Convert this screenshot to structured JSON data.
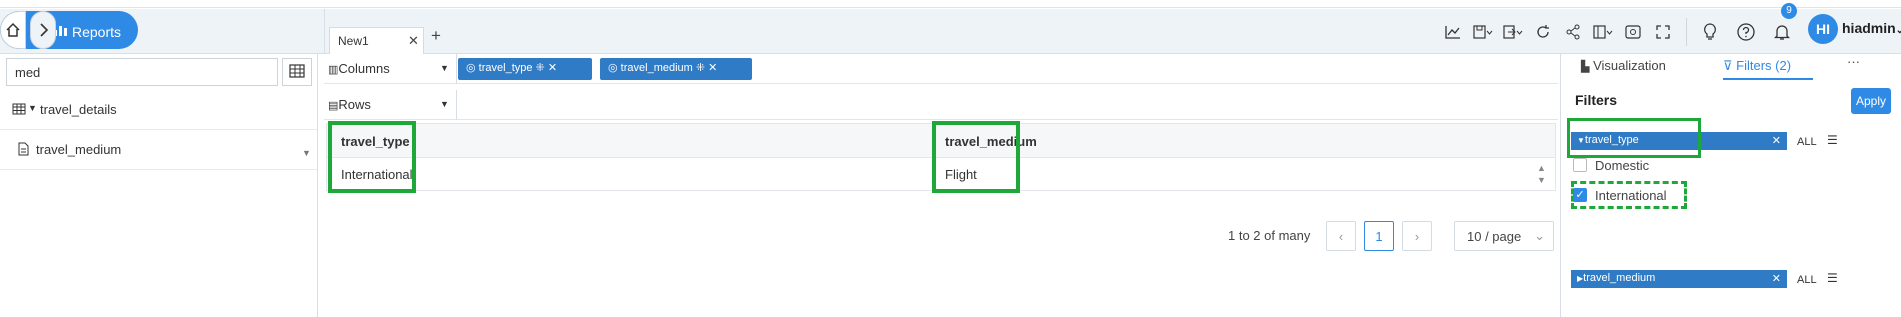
{
  "nav": {
    "breadcrumb_label": "Reports"
  },
  "tabs": [
    {
      "label": "New1"
    }
  ],
  "user": {
    "initials": "HI",
    "name": "hiadmin",
    "notifications": "9"
  },
  "left": {
    "search_value": "med",
    "tree": [
      {
        "label": "travel_details",
        "kind": "table"
      },
      {
        "label": "travel_medium",
        "kind": "field"
      }
    ]
  },
  "shelves": {
    "columns_label": "Columns",
    "rows_label": "Rows",
    "column_chips": [
      "travel_type",
      "travel_medium"
    ]
  },
  "table": {
    "headers": [
      "travel_type",
      "travel_medium"
    ],
    "rows": [
      [
        "International",
        "Flight"
      ]
    ]
  },
  "pager": {
    "summary": "1 to 2 of many",
    "current": "1",
    "page_size": "10 / page"
  },
  "right": {
    "tabs": [
      "Visualization",
      "Filters (2)",
      "···"
    ],
    "title": "Filters",
    "apply_label": "Apply",
    "filters": [
      {
        "name": "travel_type",
        "all_label": "ALL",
        "options": [
          {
            "label": "Domestic",
            "checked": false
          },
          {
            "label": "International",
            "checked": true
          }
        ]
      },
      {
        "name": "travel_medium",
        "all_label": "ALL",
        "options": []
      }
    ]
  },
  "colors": {
    "accent": "#2f8ae6",
    "chip": "#2f7bc6",
    "highlight": "#1fa83a"
  }
}
